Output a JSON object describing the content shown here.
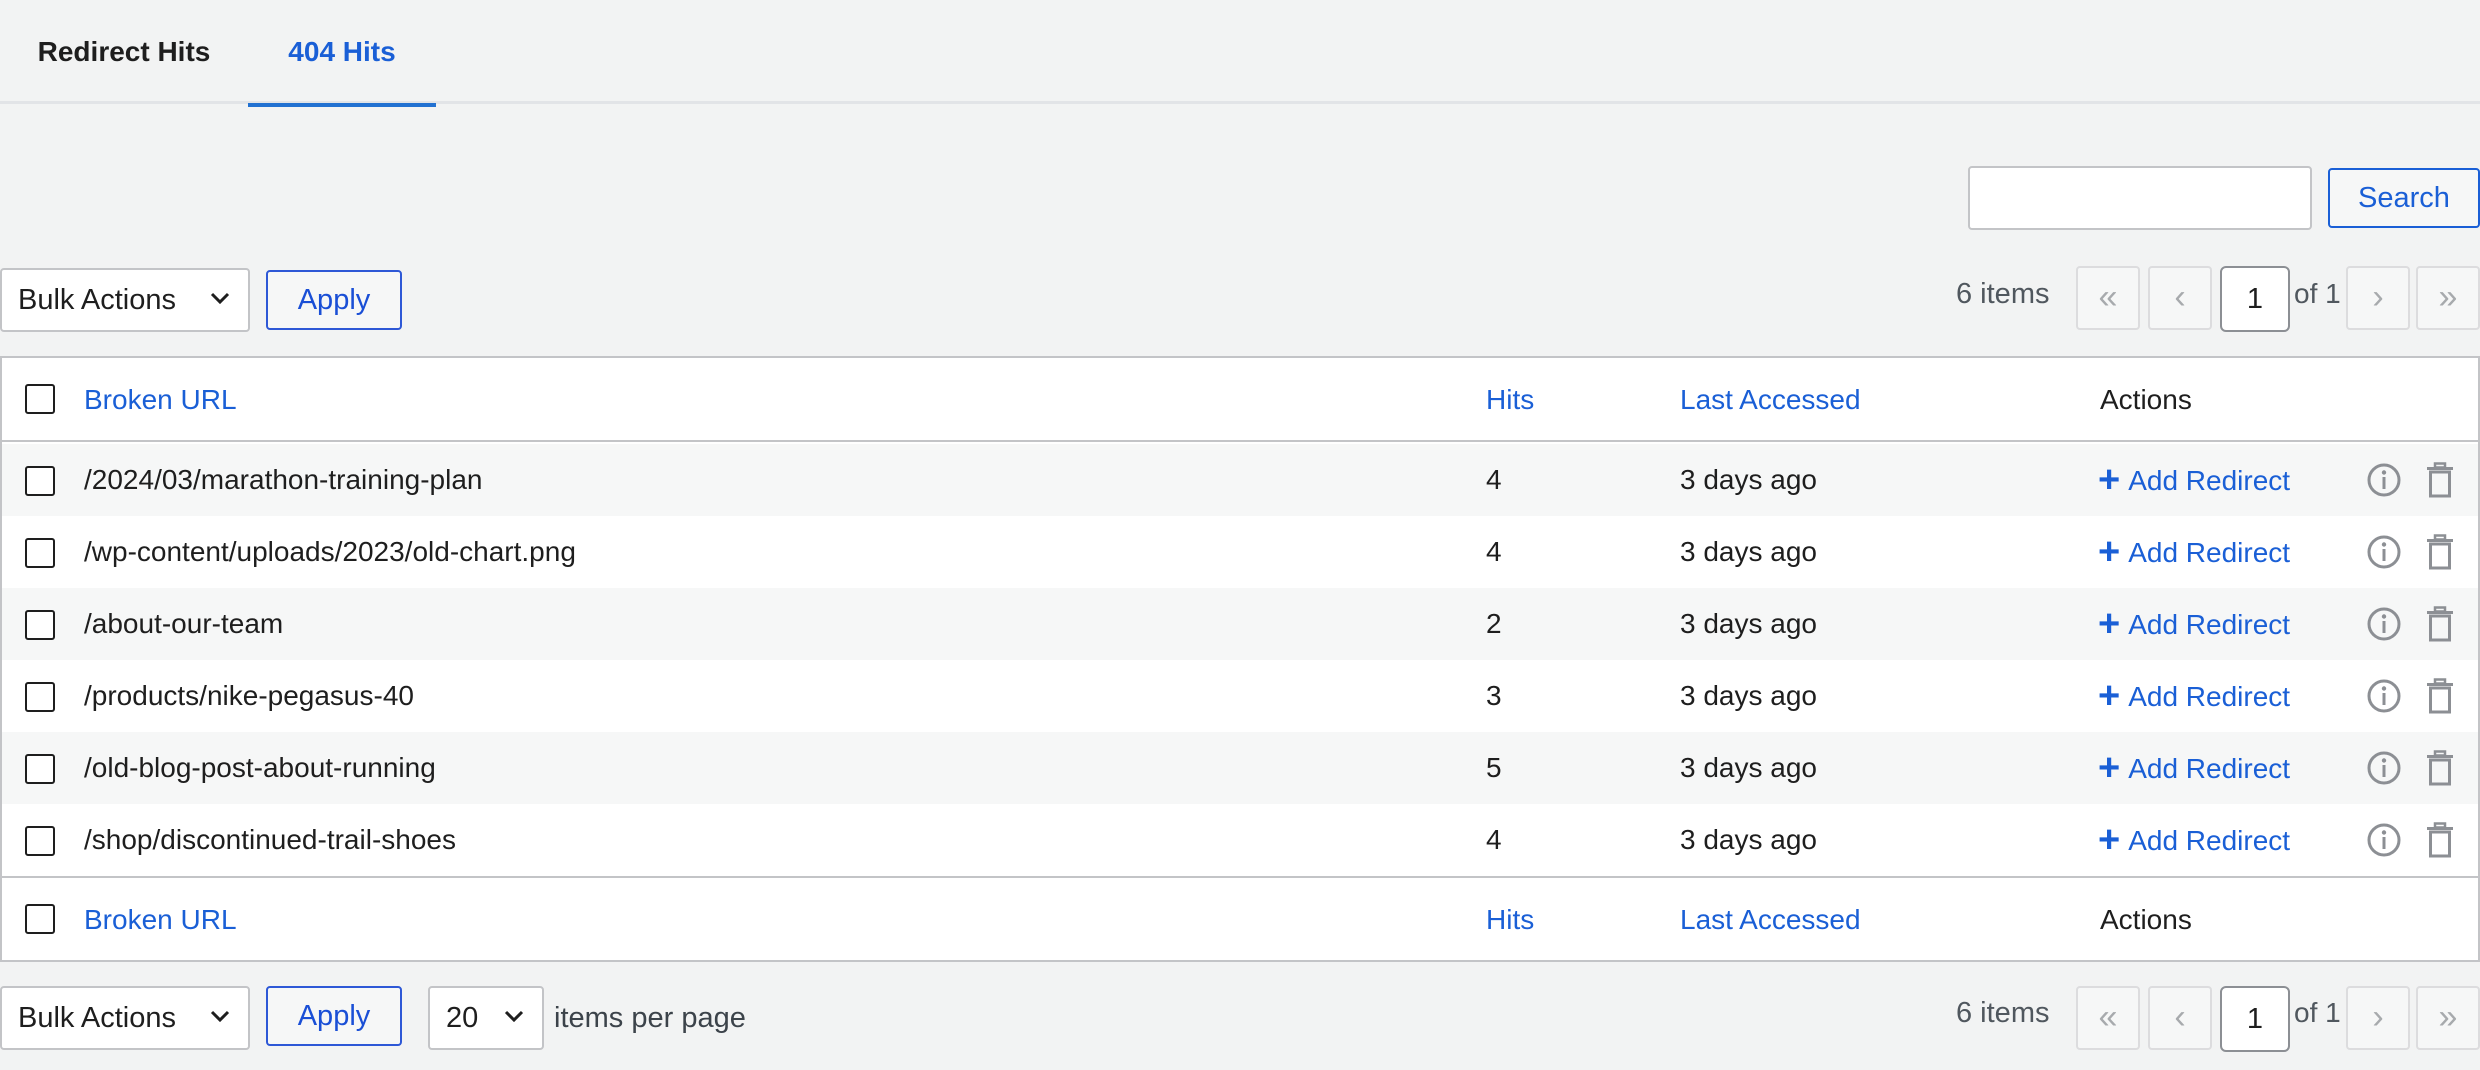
{
  "tabs": [
    {
      "label": "Redirect Hits"
    },
    {
      "label": "404 Hits"
    }
  ],
  "search": {
    "button_label": "Search",
    "value": ""
  },
  "bulk": {
    "label": "Bulk Actions",
    "apply_label": "Apply"
  },
  "pagination": {
    "items_label": "6 items",
    "first": "«",
    "prev": "‹",
    "next": "›",
    "last": "»",
    "current_page": "1",
    "of_label": "of 1"
  },
  "per_page": {
    "value": "20",
    "label": "items per page"
  },
  "table": {
    "columns": {
      "url": "Broken URL",
      "hits": "Hits",
      "last": "Last Accessed",
      "actions": "Actions"
    },
    "add_redirect_label": "Add Redirect",
    "rows": [
      {
        "url": "/2024/03/marathon-training-plan",
        "hits": "4",
        "last": "3 days ago"
      },
      {
        "url": "/wp-content/uploads/2023/old-chart.png",
        "hits": "4",
        "last": "3 days ago"
      },
      {
        "url": "/about-our-team",
        "hits": "2",
        "last": "3 days ago"
      },
      {
        "url": "/products/nike-pegasus-40",
        "hits": "3",
        "last": "3 days ago"
      },
      {
        "url": "/old-blog-post-about-running",
        "hits": "5",
        "last": "3 days ago"
      },
      {
        "url": "/shop/discontinued-trail-shoes",
        "hits": "4",
        "last": "3 days ago"
      }
    ]
  },
  "icons": {
    "info": "info-icon",
    "trash": "trash-icon",
    "plus": "plus-icon",
    "chevron": "chevron-down-icon"
  },
  "colors": {
    "accent": "#1a5fd6",
    "background": "#f2f3f3"
  }
}
